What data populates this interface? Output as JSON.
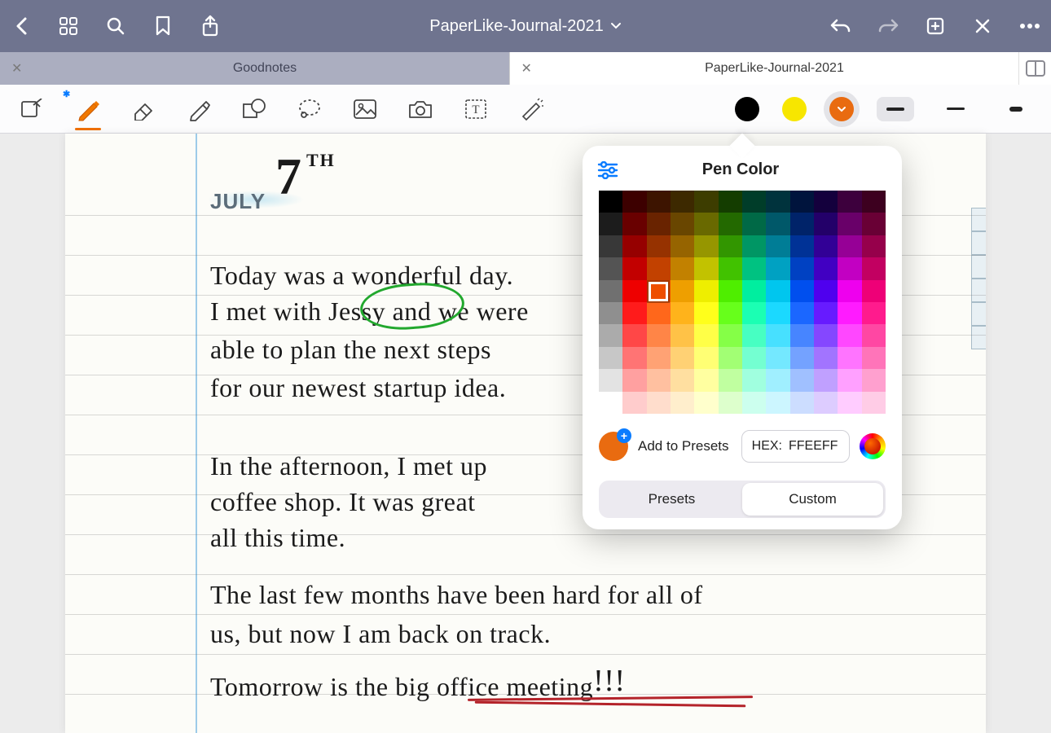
{
  "titlebar": {
    "title": "PaperLike-Journal-2021"
  },
  "tabs": {
    "first": "Goodnotes",
    "second": "PaperLike-Journal-2021"
  },
  "colors": {
    "black": "#000000",
    "yellow": "#f7e600",
    "orange": "#e96b10"
  },
  "popover": {
    "title": "Pen Color",
    "add_label": "Add to Presets",
    "hex_label": "HEX:",
    "hex_value": "FFEEFF",
    "tab_presets": "Presets",
    "tab_custom": "Custom",
    "swatch": "#e96b10"
  },
  "journal": {
    "month": "JULY",
    "day": "7",
    "th": "TH",
    "l1": "Today was a wonderful day.",
    "l2a": "I met with ",
    "l2b": "Jessy",
    "l2c": " and we were",
    "l3": "able to plan the next steps",
    "l4": "for our newest startup idea.",
    "l5": "In the afternoon, I met up",
    "l6": "coffee shop. It was great",
    "l7": "all this time.",
    "l8": "The last few months have been hard for all of",
    "l9": "us, but now I am back on track.",
    "l10a": "Tomorrow is the ",
    "l10b": "big office meeting",
    "l10c": "!!!"
  }
}
